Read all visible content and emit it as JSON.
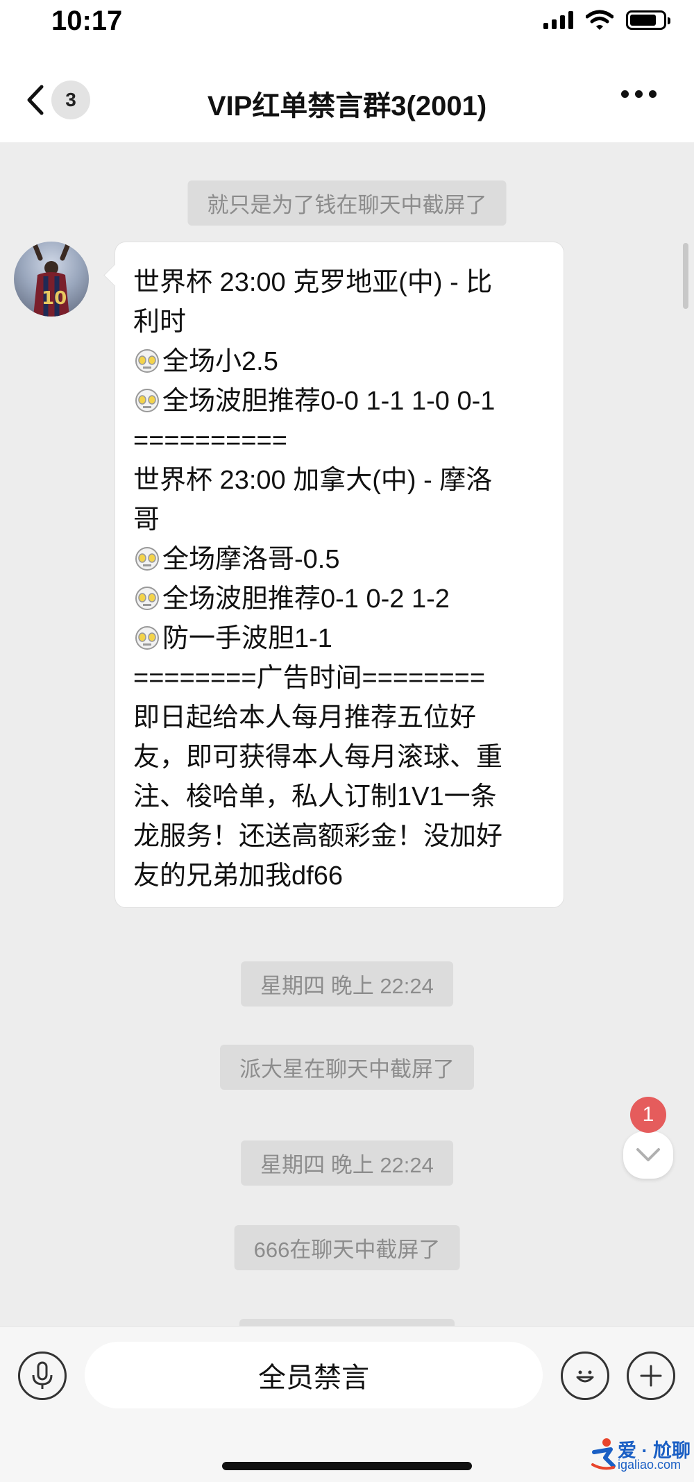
{
  "status_bar": {
    "time": "10:17"
  },
  "nav": {
    "unread_count": "3",
    "title": "VIP红单禁言群3(2001)"
  },
  "chat": {
    "system_messages": [
      "就只是为了钱在聊天中截屏了",
      "星期四 晚上 22:24",
      "派大星在聊天中截屏了",
      "星期四 晚上 22:24",
      "666在聊天中截屏了"
    ],
    "message_lines": [
      "世界杯 23:00 克罗地亚(中) - 比",
      "利时",
      "全场小2.5",
      "全场波胆推荐0-0 1-1 1-0 0-1",
      "==========",
      "世界杯 23:00 加拿大(中) - 摩洛",
      "哥",
      "全场摩洛哥-0.5",
      "全场波胆推荐0-1 0-2 1-2",
      "防一手波胆1-1",
      "========广告时间========",
      "即日起给本人每月推荐五位好",
      "友，即可获得本人每月滚球、重",
      "注、梭哈单，私人订制1V1一条",
      "龙服务！还送高额彩金！没加好",
      "友的兄弟加我df66"
    ],
    "new_message_count": "1"
  },
  "bottom_bar": {
    "mute_label": "全员禁言"
  },
  "watermark": {
    "brand": "爱 · 尬聊",
    "domain": "igaliao.com"
  },
  "icons": {
    "back": "chevron-left-icon",
    "more": "more-dots-icon",
    "voice": "microphone-icon",
    "emoji": "smiley-icon",
    "plus": "plus-icon",
    "scroll_down": "chevron-down-icon",
    "message_emoji": "robot-face-icon"
  },
  "colors": {
    "background": "#ededed",
    "bubble": "#ffffff",
    "badge_red": "#e55c5c",
    "system_text": "#8c8c8c"
  }
}
